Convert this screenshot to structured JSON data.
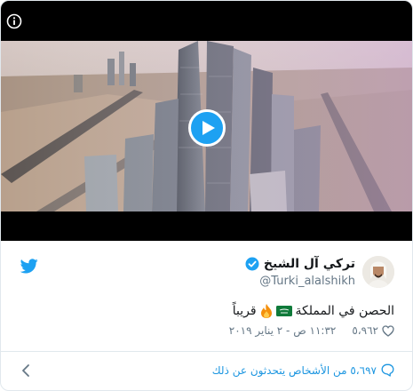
{
  "media": {
    "icon": "info-icon",
    "play_icon": "play-icon",
    "accent": "#1da1f2"
  },
  "tweet": {
    "display_name": "تركي آل الشيخ",
    "handle": "@Turki_alalshikh",
    "verified_icon": "verified-badge-icon",
    "text_prefix": "الحصن في المملكة",
    "text_suffix": "قريباً",
    "emoji": [
      "saudi-flag-icon",
      "fire-icon"
    ],
    "likes": "٥،٩٦٢",
    "timestamp": "١١:٣٢ ص - ٢ يناير ٢٠١٩"
  },
  "footer": {
    "link_text": "٥،٦٩٧ من الأشخاص يتحدثون عن ذلك"
  },
  "colors": {
    "twitter_blue": "#1da1f2",
    "link": "#1b95e0",
    "secondary_text": "#657786"
  }
}
